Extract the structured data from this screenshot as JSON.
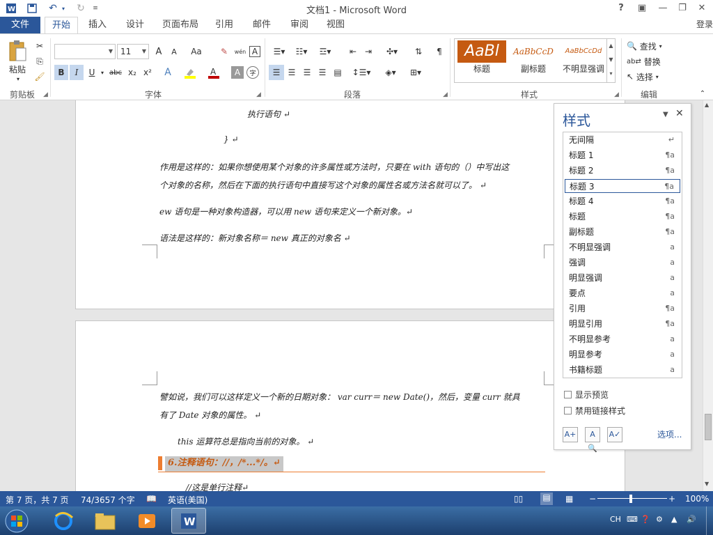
{
  "window": {
    "title": "文档1 - Microsoft Word",
    "help": "?",
    "login": "登录"
  },
  "tabs": {
    "file": "文件",
    "items": [
      "开始",
      "插入",
      "设计",
      "页面布局",
      "引用",
      "邮件",
      "审阅",
      "视图"
    ],
    "active": "开始"
  },
  "ribbon": {
    "clipboard": {
      "paste": "粘贴",
      "group": "剪贴板"
    },
    "font": {
      "group": "字体",
      "size": "11",
      "font_name": "",
      "size_up": "A",
      "size_down": "A",
      "case": "Aa",
      "bold": "B",
      "italic": "I",
      "underline": "U",
      "strike": "abc",
      "sub": "x₂",
      "sup": "x²",
      "pinyin": "wén",
      "charborder": "A",
      "shade": "A",
      "circle": "字"
    },
    "paragraph": {
      "group": "段落"
    },
    "styles": {
      "group": "样式",
      "items": [
        {
          "preview": "AaBl",
          "name": "标题"
        },
        {
          "preview": "AaBbCcD",
          "name": "副标题"
        },
        {
          "preview": "AaBbCcDd",
          "name": "不明显强调"
        }
      ]
    },
    "editing": {
      "group": "编辑",
      "find": "查找",
      "replace": "替换",
      "select": "选择"
    }
  },
  "document": {
    "page1": [
      "执行语句 ↵",
      "} ↵",
      "作用是这样的：如果你想使用某个对象的许多属性或方法时，只要在 with 语句的（）中写出这",
      "个对象的名称，然后在下面的执行语句中直接写这个对象的属性名或方法名就可以了。 ↵",
      "ew 语句是一种对象构造器，可以用 new 语句来定义一个新对象。↵",
      "语法是这样的：新对象名称＝ new  真正的对象名 ↵"
    ],
    "page2": [
      "譬如说，我们可以这样定义一个新的日期对象：  var curr＝ new Date()，然后，变量 curr 就具",
      "有了 Date 对象的属性。 ↵",
      "this 运算符总是指向当前的对象。 ↵",
      "6.注释语句：//，/*...*/。↵",
      "//这是单行注释↵"
    ]
  },
  "styles_pane": {
    "title": "样式",
    "items": [
      {
        "name": "无间隔",
        "mark": "↵"
      },
      {
        "name": "标题 1",
        "mark": "¶a"
      },
      {
        "name": "标题 2",
        "mark": "¶a"
      },
      {
        "name": "标题 3",
        "mark": "¶a"
      },
      {
        "name": "标题 4",
        "mark": "¶a"
      },
      {
        "name": "标题",
        "mark": "¶a"
      },
      {
        "name": "副标题",
        "mark": "¶a"
      },
      {
        "name": "不明显强调",
        "mark": "a"
      },
      {
        "name": "强调",
        "mark": "a"
      },
      {
        "name": "明显强调",
        "mark": "a"
      },
      {
        "name": "要点",
        "mark": "a"
      },
      {
        "name": "引用",
        "mark": "¶a"
      },
      {
        "name": "明显引用",
        "mark": "¶a"
      },
      {
        "name": "不明显参考",
        "mark": "a"
      },
      {
        "name": "明显参考",
        "mark": "a"
      },
      {
        "name": "书籍标题",
        "mark": "a"
      }
    ],
    "selected": "标题 3",
    "show_preview": "显示预览",
    "disable_linked": "禁用链接样式",
    "options": "选项..."
  },
  "statusbar": {
    "page": "第 7 页，共 7 页",
    "words": "74/3657 个字",
    "lang": "英语(美国)",
    "zoom": "100%"
  },
  "tray": {
    "lang": "CH"
  },
  "colors": {
    "accent": "#2b579a",
    "heading_orange": "#c55a11"
  }
}
